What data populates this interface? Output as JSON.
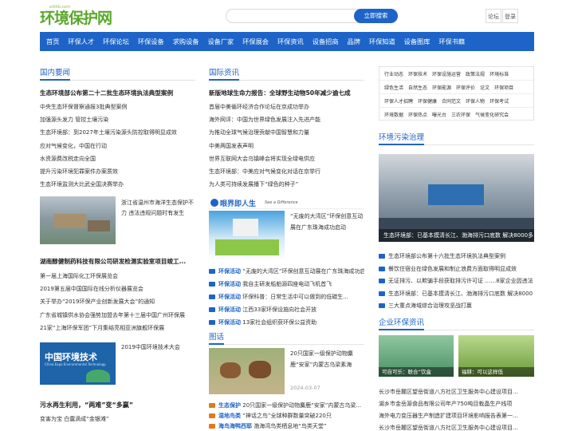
{
  "header": {
    "logo_text": "环境保护网",
    "logo_sub": "efzhb.com",
    "search_button": "立即搜索",
    "links": [
      "论坛",
      "登录"
    ]
  },
  "nav": [
    "首页",
    "环保人才",
    "环保论坛",
    "环保设备",
    "求购设备",
    "设备厂家",
    "环保展会",
    "环保资讯",
    "设备招商",
    "品牌",
    "环保知道",
    "设备图库",
    "环保书籍"
  ],
  "domestic": {
    "title": "国内要闻",
    "headline": "生态环境部公布第二十二批生态环境执法典型案例",
    "items": [
      "中央生态环保督察通报3批典型案例",
      "加强源头发力 管控土壤污染",
      "生态环境部：到2027年土壤污染源头防控取得明显成效",
      "应对气候变化，中国在行动",
      "水资源费改税走向全国",
      "提升污染环境犯罪案件办案质效",
      "生态环境监测大比武全国决赛举办"
    ],
    "photo_caption": "浙江省温州市海洋生态保护不力 违法违规问题时有发生",
    "headline2": "湖南醇健制药科技有限公司研发检测实验室项目竣工...",
    "items2": [
      "第一届上海国际化工环保展览会",
      "2019第五届中国国际在线分析仪器展览会",
      "关于举办“2019环保产业创新发展大会”的通知",
      "广东省城镇供水协会强势加盟去年第十三届中国广州环保展",
      "21家“上海环保军团”下月集结亮相亚洲旗舰环保展"
    ],
    "expo_banner_cn": "中国环境技术",
    "expo_banner_en": "China Expo Environmental Technology",
    "expo_caption": "2019中国环境技术大会",
    "headline3": "污水再生利用，“两难”变“多赢”",
    "items3": [
      "变害为宝 白露滴成“金银滩”"
    ]
  },
  "international": {
    "title": "国际资讯",
    "headline": "新版地球生命力报告：全球野生动物50年减少逾七成",
    "items": [
      "首届中美循环经济合作论坛在京成功举办",
      "海外网评：中国为世界绿色发展注入先进产能",
      "为推动全球气候治理贡献中国智慧和力量",
      "中美两国发表声明",
      "世界互联网大会乌镇峰会将实现全绿电供应",
      "生态环境部：中美应对气候变化对话在京举行",
      "为人类可持续发展播下“绿色的种子”"
    ],
    "banner_title": "眼界即人生",
    "banner_sub": "See a Difference",
    "feature_caption": "“无废的大湾区”环保创意互动展在广东珠海成功启动",
    "activity_tag": "环保活动",
    "activities": [
      "“无废的大湾区”环保创意互动展在广东珠海成功启动",
      "我自主研发船舶源四座电动飞机首飞",
      "环保科普：日常生活中可以做到的低碳生...",
      "江西33家环保设施向社会开放",
      "13家社会组织获环保公益资助"
    ]
  },
  "photos": {
    "title": "图话",
    "caption": "20只国家一级保护动物麋鹿“安家”内蒙古乌梁素海",
    "date": "2024-03-07",
    "tags": [
      "生态保护",
      "湿地鸟类",
      "海鸟海鸭西耶"
    ],
    "items": [
      "20只国家一级保护动物麋鹿“安家”内蒙古乌梁...",
      "“神话之鸟”全球种群数量突破220只",
      "渤海湾鸟类栖息地“鸟类天堂”"
    ]
  },
  "sidebar": {
    "grid": [
      [
        "行业动态",
        "环保技术",
        "环保设施运营",
        "政策法规",
        "环境标准"
      ],
      [
        "绿色生活",
        "自然生态",
        "环保能源",
        "环保评价",
        "论文",
        "环保项目"
      ],
      [
        "环保人才招聘",
        "环保健康",
        "合同范文",
        "环保人物",
        "环保考试"
      ],
      [
        "环境数据",
        "环保热点",
        "曝光台",
        "三农环保",
        "气候变化研究会"
      ]
    ],
    "pollution_title": "环境污染治理",
    "pollution_caption": "生态环境部：已基本摸清长江、渤海排污口底数 解决8000多",
    "pollution_items": [
      "生态环境部公布第十六批生态环境执法典型案例",
      "餐饮住宿业在绿色发展和制止浪费方面取得明显成效",
      "无证排污、以欺骗手段获取排污许可证 ……8家企业因违法",
      "生态环境部：已基本摸清长江、渤海排污口底数 解决8000",
      "三大重点海域综合治理攻坚战打赢"
    ],
    "company_title": "企业环保资讯",
    "company_captions": [
      "可自可乐：联合“饮盒",
      "福耕：可以这样低"
    ],
    "company_items": [
      "长沙市岳麓区望岳街道八方社区卫生服务中心建设项目...",
      "湖乡市金岳源食品有限公司年产750吨目栽晶生产线项",
      "海外电力变压器生产制造扩建项目环境影响报告表第一...",
      "长沙市岳麓区望岳街道八方社区卫生服务中心建设项目..."
    ]
  }
}
